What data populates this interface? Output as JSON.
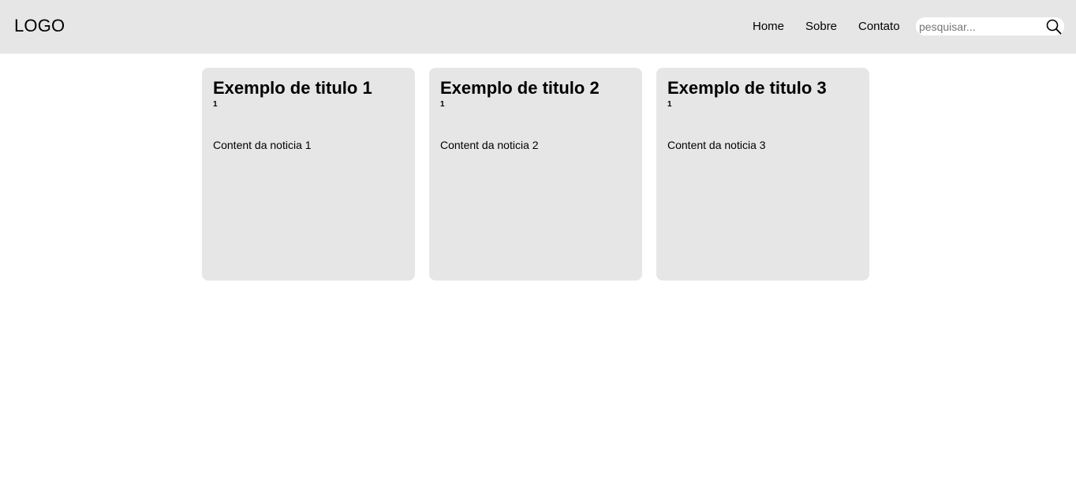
{
  "header": {
    "logo": "LOGO",
    "nav": [
      "Home",
      "Sobre",
      "Contato"
    ],
    "search": {
      "placeholder": "pesquisar...",
      "value": "",
      "icon": "search-icon"
    }
  },
  "cards": [
    {
      "title": "Exemplo de titulo 1",
      "subtitle": "1",
      "content": "Content da noticia 1"
    },
    {
      "title": "Exemplo de titulo 2",
      "subtitle": "1",
      "content": "Content da noticia 2"
    },
    {
      "title": "Exemplo de titulo 3",
      "subtitle": "1",
      "content": "Content da noticia 3"
    }
  ],
  "colors": {
    "header_background": "#e6e6e6",
    "card_background": "#e6e6e6",
    "page_background": "#ffffff",
    "text": "#000000"
  }
}
